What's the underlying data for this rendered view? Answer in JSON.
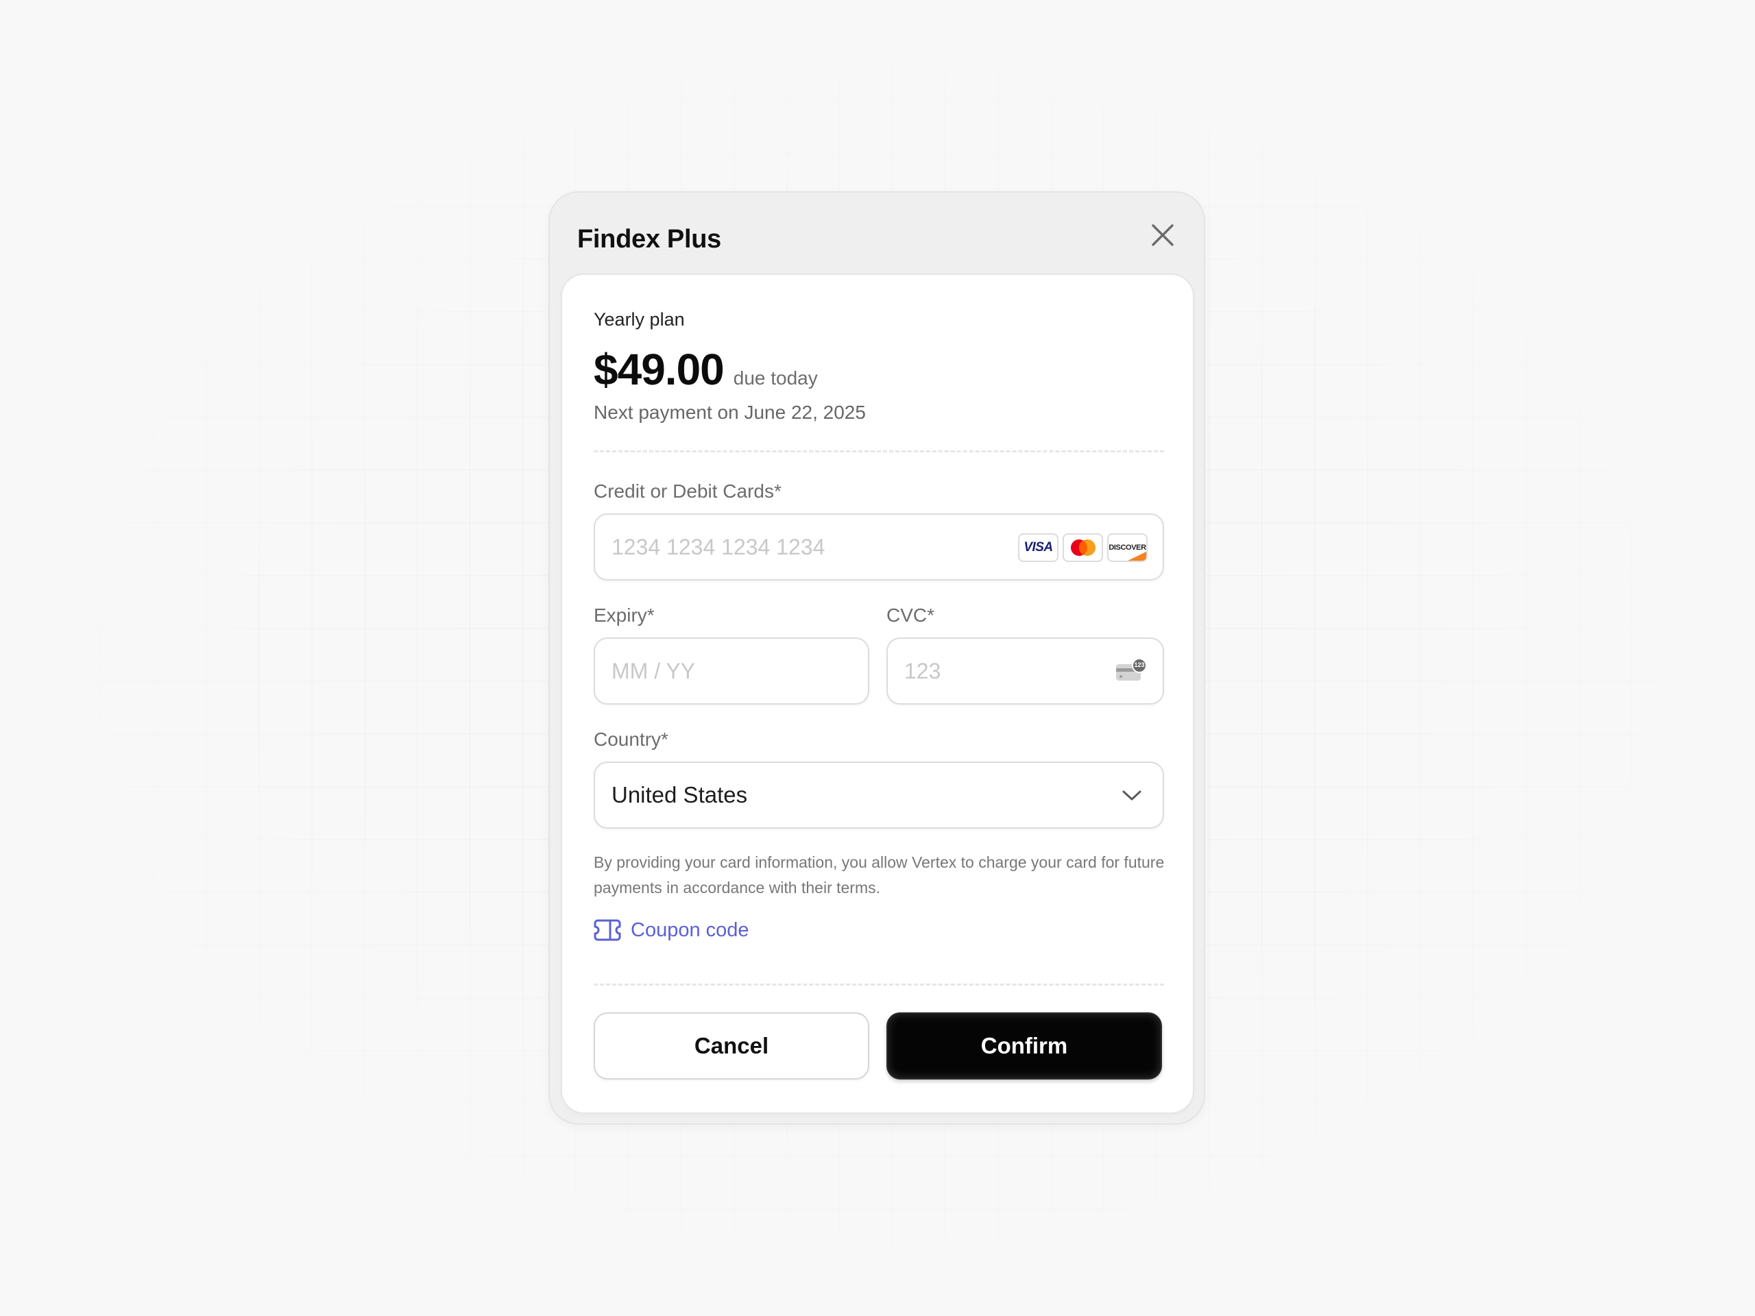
{
  "modal": {
    "title": "Findex Plus",
    "close_icon": "close-icon"
  },
  "plan": {
    "label": "Yearly plan",
    "price": "$49.00",
    "due_text": "due today",
    "next_payment": "Next payment on June 22, 2025"
  },
  "form": {
    "card": {
      "label": "Credit or Debit Cards*",
      "placeholder": "1234 1234 1234 1234",
      "brands": {
        "visa": "VISA",
        "mastercard": "mastercard",
        "discover": "DISCOVER"
      }
    },
    "expiry": {
      "label": "Expiry*",
      "placeholder": "MM / YY"
    },
    "cvc": {
      "label": "CVC*",
      "placeholder": "123",
      "icon_badge": "123",
      "icon": "cvc-card-icon"
    },
    "country": {
      "label": "Country*",
      "value": "United States",
      "icon": "chevron-down-icon"
    }
  },
  "disclaimer": "By providing your card information, you allow Vertex to charge your card for future payments in accordance with their terms.",
  "coupon": {
    "label": "Coupon code",
    "icon": "ticket-icon"
  },
  "actions": {
    "cancel": "Cancel",
    "confirm": "Confirm"
  },
  "colors": {
    "background": "#f8f8f8",
    "modal_bg": "#efefef",
    "card_bg": "#ffffff",
    "accent_link": "#5a5fd8",
    "primary_button": "#050505",
    "text_primary": "#111111",
    "text_secondary": "#6c6c6c",
    "placeholder": "#c8c8c8"
  }
}
